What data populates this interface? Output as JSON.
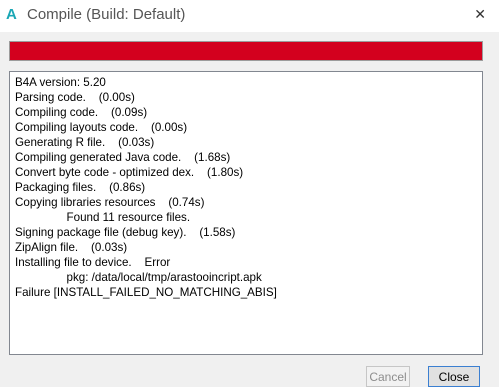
{
  "window": {
    "app_icon_glyph": "A",
    "title": "Compile (Build: Default)",
    "close_glyph": "✕"
  },
  "progress": {
    "fraction": 1.0,
    "color": "#d3001e"
  },
  "log": {
    "lines": [
      "B4A version: 5.20",
      "Parsing code.    (0.00s)",
      "Compiling code.    (0.09s)",
      "Compiling layouts code.    (0.00s)",
      "Generating R file.    (0.03s)",
      "Compiling generated Java code.    (1.68s)",
      "Convert byte code - optimized dex.    (1.80s)",
      "Packaging files.    (0.86s)",
      "Copying libraries resources    (0.74s)",
      "                Found 11 resource files.",
      "Signing package file (debug key).    (1.58s)",
      "ZipAlign file.    (0.03s)",
      "Installing file to device.    Error",
      "                pkg: /data/local/tmp/arastooincript.apk",
      "Failure [INSTALL_FAILED_NO_MATCHING_ABIS]"
    ]
  },
  "buttons": {
    "cancel_label": "Cancel",
    "close_label": "Close"
  }
}
